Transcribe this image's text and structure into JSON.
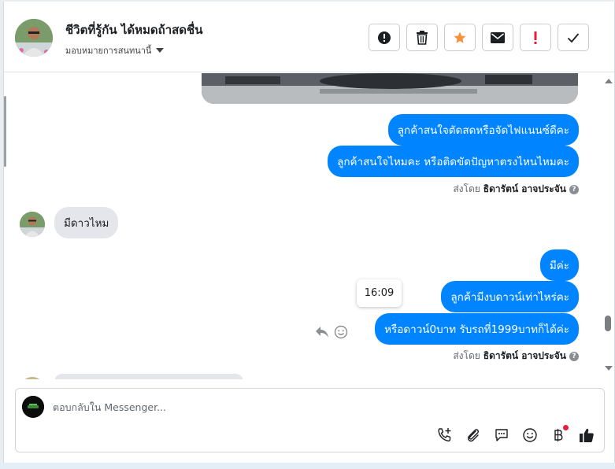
{
  "header": {
    "title": "ชีวิตที่รู้กัน ได้หมดถ้าสดชื่น",
    "subtitle": "มอบหมายการสนทนานี้",
    "actions": [
      "alert-circle-icon",
      "trash-icon",
      "star-icon",
      "envelope-icon",
      "exclamation-icon",
      "check-icon"
    ]
  },
  "colors": {
    "accent": "#0084ff",
    "star": "#f7923b",
    "alert": "#e41e3f",
    "incoming_bg": "#e4e6eb"
  },
  "messages": {
    "out1": "ลูกค้าสนใจตัดสดหรือจัดไฟแนนซ์ดีคะ",
    "out2": "ลูกค้าสนใจไหมคะ หรือติดขัดปัญหาตรงไหนไหมคะ",
    "sent_by_prefix": "ส่งโดย",
    "sent_by_name": "ธิดารัตน์ อาจประจัน",
    "in1": "มีดาวไหม",
    "out3": "มีค่ะ",
    "out4": "ลูกค้ามีงบดาวน์เท่าไหร่คะ",
    "out5": "หรือดาวน์0บาท รับรถที่1999บาทก็ได้ค่ะ",
    "tooltip_time": "16:09"
  },
  "composer": {
    "placeholder": "ตอบกลับใน Messenger...",
    "tools": [
      "phone-plus-icon",
      "paperclip-icon",
      "chat-bubble-icon",
      "smiley-icon",
      "baht-icon",
      "thumbs-up-icon"
    ]
  }
}
